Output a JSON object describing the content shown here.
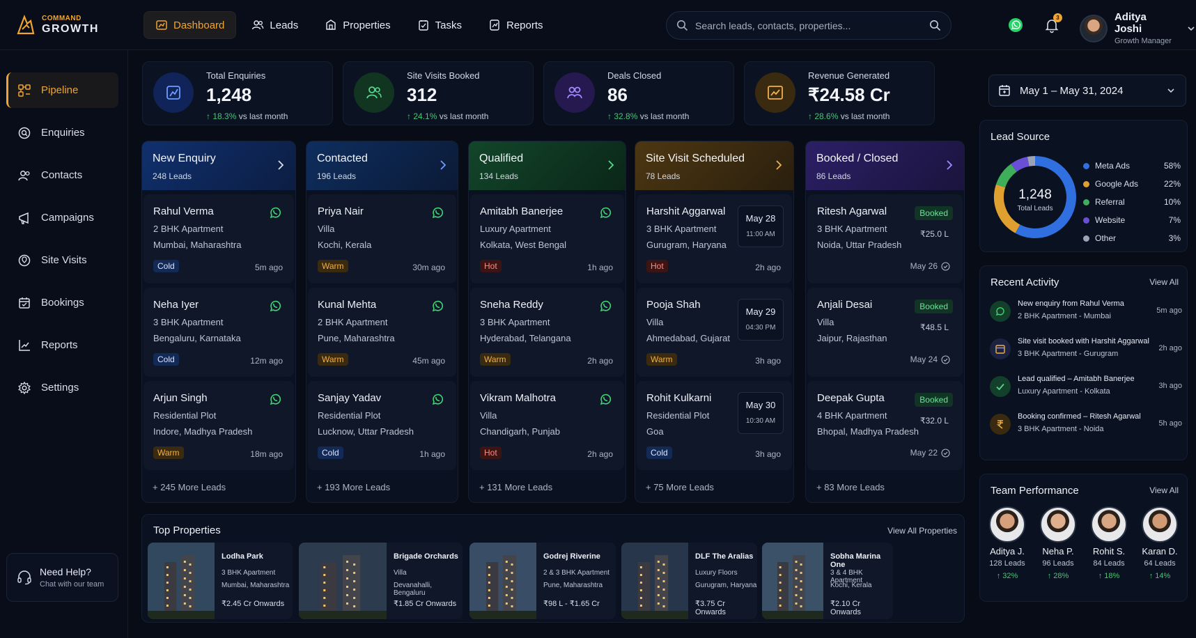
{
  "brand": {
    "line1": "COMMAND",
    "line2": "GROWTH"
  },
  "nav": [
    {
      "label": "Dashboard"
    },
    {
      "label": "Leads"
    },
    {
      "label": "Properties"
    },
    {
      "label": "Tasks"
    },
    {
      "label": "Reports"
    }
  ],
  "search": {
    "placeholder": "Search leads, contacts, properties..."
  },
  "notifications": {
    "count": "3"
  },
  "user": {
    "name": "Aditya Joshi",
    "role": "Growth Manager"
  },
  "sidebar": [
    {
      "label": "Pipeline"
    },
    {
      "label": "Enquiries"
    },
    {
      "label": "Contacts"
    },
    {
      "label": "Campaigns"
    },
    {
      "label": "Site Visits"
    },
    {
      "label": "Bookings"
    },
    {
      "label": "Reports"
    },
    {
      "label": "Settings"
    }
  ],
  "help": {
    "title": "Need Help?",
    "subtitle": "Chat with our team"
  },
  "stats": [
    {
      "label": "Total Enquiries",
      "value": "1,248",
      "change": "↑ 18.3%",
      "suffix": "vs last month"
    },
    {
      "label": "Site Visits Booked",
      "value": "312",
      "change": "↑ 24.1%",
      "suffix": "vs last month"
    },
    {
      "label": "Deals Closed",
      "value": "86",
      "change": "↑ 32.8%",
      "suffix": "vs last month"
    },
    {
      "label": "Revenue Generated",
      "value": "₹24.58 Cr",
      "change": "↑ 28.6%",
      "suffix": "vs last month"
    }
  ],
  "columns": [
    {
      "title": "New Enquiry",
      "count": "248 Leads",
      "more": "+ 245 More Leads",
      "cards": [
        {
          "name": "Rahul Verma",
          "type": "2 BHK Apartment",
          "location": "Mumbai, Maharashtra",
          "tag": "Cold",
          "time": "5m ago"
        },
        {
          "name": "Neha Iyer",
          "type": "3 BHK Apartment",
          "location": "Bengaluru, Karnataka",
          "tag": "Cold",
          "time": "12m ago"
        },
        {
          "name": "Arjun Singh",
          "type": "Residential Plot",
          "location": "Indore, Madhya Pradesh",
          "tag": "Warm",
          "time": "18m ago"
        }
      ]
    },
    {
      "title": "Contacted",
      "count": "196 Leads",
      "more": "+ 193 More Leads",
      "cards": [
        {
          "name": "Priya Nair",
          "type": "Villa",
          "location": "Kochi, Kerala",
          "tag": "Warm",
          "time": "30m ago"
        },
        {
          "name": "Kunal Mehta",
          "type": "2 BHK Apartment",
          "location": "Pune, Maharashtra",
          "tag": "Warm",
          "time": "45m ago"
        },
        {
          "name": "Sanjay Yadav",
          "type": "Residential Plot",
          "location": "Lucknow, Uttar Pradesh",
          "tag": "Cold",
          "time": "1h ago"
        }
      ]
    },
    {
      "title": "Qualified",
      "count": "134 Leads",
      "more": "+ 131 More Leads",
      "cards": [
        {
          "name": "Amitabh Banerjee",
          "type": "Luxury Apartment",
          "location": "Kolkata, West Bengal",
          "tag": "Hot",
          "time": "1h ago"
        },
        {
          "name": "Sneha Reddy",
          "type": "3 BHK Apartment",
          "location": "Hyderabad, Telangana",
          "tag": "Warm",
          "time": "2h ago"
        },
        {
          "name": "Vikram Malhotra",
          "type": "Villa",
          "location": "Chandigarh, Punjab",
          "tag": "Hot",
          "time": "2h ago"
        }
      ]
    },
    {
      "title": "Site Visit Scheduled",
      "count": "78 Leads",
      "more": "+ 75 More Leads",
      "cards": [
        {
          "name": "Harshit Aggarwal",
          "type": "3 BHK Apartment",
          "location": "Gurugram, Haryana",
          "tag": "Hot",
          "time": "2h ago",
          "date": "May 28",
          "slot": "11:00 AM"
        },
        {
          "name": "Pooja Shah",
          "type": "Villa",
          "location": "Ahmedabad, Gujarat",
          "tag": "Warm",
          "time": "3h ago",
          "date": "May 29",
          "slot": "04:30 PM"
        },
        {
          "name": "Rohit Kulkarni",
          "type": "Residential Plot",
          "location": "Goa",
          "tag": "Cold",
          "time": "3h ago",
          "date": "May 30",
          "slot": "10:30 AM"
        }
      ]
    },
    {
      "title": "Booked / Closed",
      "count": "86 Leads",
      "more": "+ 83 More Leads",
      "cards": [
        {
          "name": "Ritesh Agarwal",
          "type": "3 BHK Apartment",
          "location": "Noida, Uttar Pradesh",
          "status": "Booked",
          "amount": "₹25.0 L",
          "bdate": "May 26"
        },
        {
          "name": "Anjali Desai",
          "type": "Villa",
          "location": "Jaipur, Rajasthan",
          "status": "Booked",
          "amount": "₹48.5 L",
          "bdate": "May 24"
        },
        {
          "name": "Deepak Gupta",
          "type": "4 BHK Apartment",
          "location": "Bhopal, Madhya Pradesh",
          "status": "Booked",
          "amount": "₹32.0 L",
          "bdate": "May 22"
        }
      ]
    }
  ],
  "properties": {
    "title": "Top Properties",
    "view_all": "View All Properties",
    "items": [
      {
        "name": "Lodha Park",
        "type": "3 BHK Apartment",
        "location": "Mumbai, Maharashtra",
        "price": "₹2.45 Cr Onwards"
      },
      {
        "name": "Brigade Orchards",
        "type": "Villa",
        "location": "Devanahalli, Bengaluru",
        "price": "₹1.85 Cr Onwards"
      },
      {
        "name": "Godrej Riverine",
        "type": "2 & 3 BHK Apartment",
        "location": "Pune, Maharashtra",
        "price": "₹98 L - ₹1.65 Cr"
      },
      {
        "name": "DLF The Aralias",
        "type": "Luxury Floors",
        "location": "Gurugram, Haryana",
        "price": "₹3.75 Cr Onwards"
      },
      {
        "name": "Sobha Marina One",
        "type": "3 & 4 BHK Apartment",
        "location": "Kochi, Kerala",
        "price": "₹2.10 Cr Onwards"
      }
    ]
  },
  "date_range": "May 1 – May 31, 2024",
  "lead_source": {
    "title": "Lead Source",
    "total": "1,248",
    "total_label": "Total Leads",
    "items": [
      {
        "name": "Meta Ads",
        "pct": "58%",
        "value": 58,
        "color": "#2f6fe0"
      },
      {
        "name": "Google Ads",
        "pct": "22%",
        "value": 22,
        "color": "#e0a030"
      },
      {
        "name": "Referral",
        "pct": "10%",
        "value": 10,
        "color": "#3fae5a"
      },
      {
        "name": "Website",
        "pct": "7%",
        "value": 7,
        "color": "#6a4fd6"
      },
      {
        "name": "Other",
        "pct": "3%",
        "value": 3,
        "color": "#9aa4b5"
      }
    ]
  },
  "activity": {
    "title": "Recent Activity",
    "view_all": "View All",
    "items": [
      {
        "title": "New enquiry from Rahul Verma",
        "sub": "2 BHK Apartment - Mumbai",
        "time": "5m ago"
      },
      {
        "title": "Site visit booked with Harshit Aggarwal",
        "sub": "3 BHK Apartment - Gurugram",
        "time": "2h ago"
      },
      {
        "title": "Lead qualified – Amitabh Banerjee",
        "sub": "Luxury Apartment - Kolkata",
        "time": "3h ago"
      },
      {
        "title": "Booking confirmed – Ritesh Agarwal",
        "sub": "3 BHK Apartment - Noida",
        "time": "5h ago"
      }
    ]
  },
  "team": {
    "title": "Team Performance",
    "view_all": "View All",
    "members": [
      {
        "name": "Aditya J.",
        "leads": "128 Leads",
        "growth": "↑ 32%"
      },
      {
        "name": "Neha P.",
        "leads": "96 Leads",
        "growth": "↑ 28%"
      },
      {
        "name": "Rohit S.",
        "leads": "84 Leads",
        "growth": "↑ 18%"
      },
      {
        "name": "Karan D.",
        "leads": "64 Leads",
        "growth": "↑ 14%"
      }
    ]
  }
}
